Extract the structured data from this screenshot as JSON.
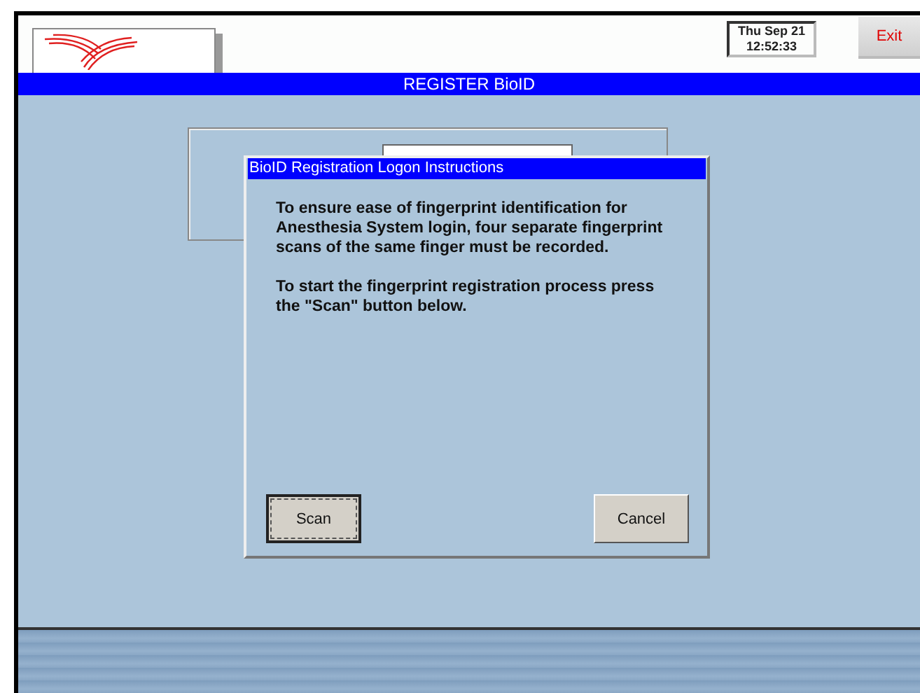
{
  "header": {
    "clock": {
      "date": "Thu Sep 21",
      "time": "12:52:33"
    },
    "exit_button": "Exit"
  },
  "title_bar": {
    "title": "REGISTER BioID"
  },
  "dialog": {
    "title": "BioID Registration Logon Instructions",
    "paragraphs": [
      "To ensure ease of fingerprint identification for Anesthesia System login, four separate fingerprint scans of the same finger must be recorded.",
      "To start the fingerprint registration process press the \"Scan\" button below."
    ],
    "buttons": [
      {
        "label": "Scan",
        "focused": true
      },
      {
        "label": "Cancel",
        "focused": false
      }
    ]
  }
}
